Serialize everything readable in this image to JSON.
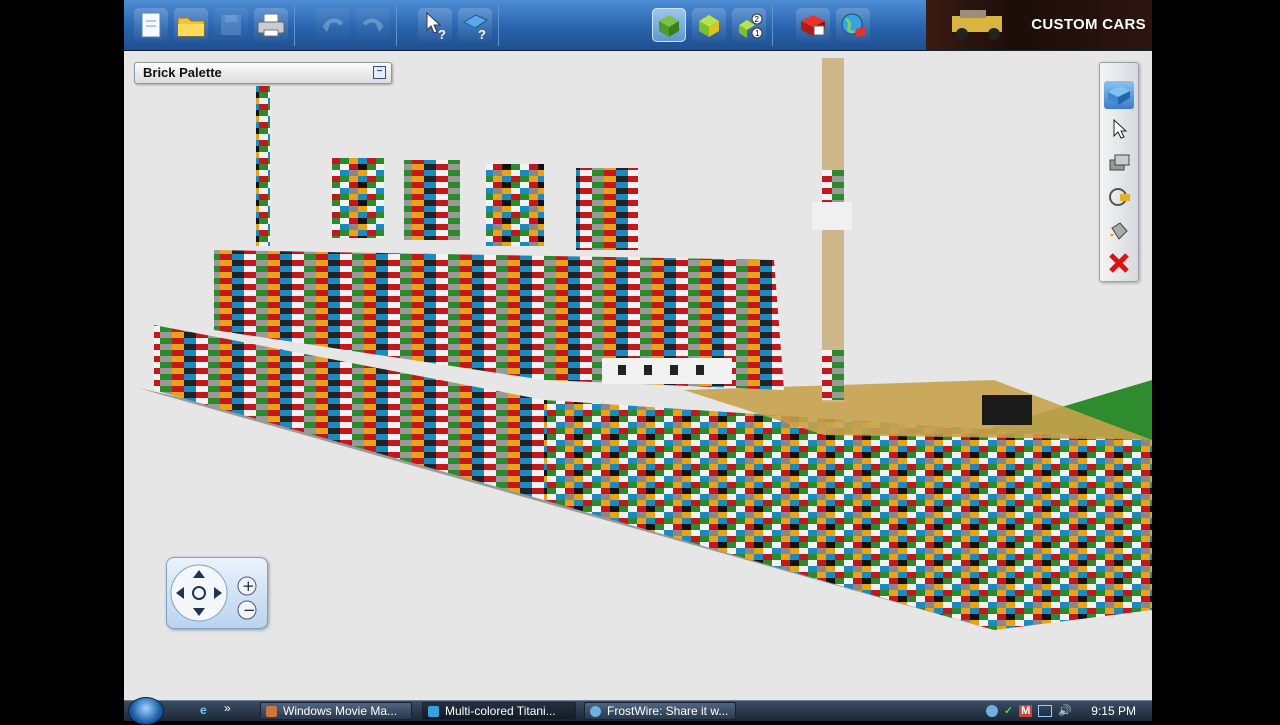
{
  "app": {
    "banner_text": "CUSTOM CARS",
    "toolbar": {
      "groups": [
        [
          "new-file-icon",
          "open-folder-icon",
          "save-icon",
          "print-icon"
        ],
        [
          "undo-icon",
          "redo-icon"
        ],
        [
          "pointer-help-icon",
          "brick-help-icon"
        ],
        [
          "build-mode-icon",
          "view-mode-icon",
          "building-guide-icon"
        ],
        [
          "bricks-shop-icon",
          "online-gallery-icon"
        ]
      ]
    },
    "brick_palette": {
      "title": "Brick Palette",
      "collapse_label": "−"
    },
    "tools": [
      "brick-icon",
      "select-arrow-icon",
      "clone-icon",
      "hinge-icon",
      "paint-bucket-icon",
      "delete-icon"
    ],
    "colors": {
      "toolbar_blue": "#2a64ad",
      "viewport_bg": "#e6e6e6",
      "baseplate_green": "#2e8b2e"
    }
  },
  "taskbar": {
    "tasks": [
      {
        "label": "Windows Movie Ma...",
        "icon": "movie-maker-icon"
      },
      {
        "label": "Multi-colored Titani...",
        "icon": "lego-app-icon"
      },
      {
        "label": "FrostWire: Share it w...",
        "icon": "frostwire-icon"
      }
    ],
    "tray_badge": "M",
    "clock": "9:15 PM"
  }
}
